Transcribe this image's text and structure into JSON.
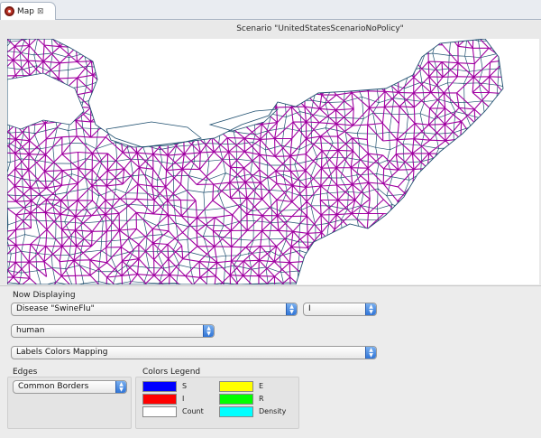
{
  "tab": {
    "label": "Map",
    "close": "⊠"
  },
  "scenario_title": "Scenario \"UnitedStatesScenarioNoPolicy\"",
  "now_displaying_label": "Now Displaying",
  "disease_select": "Disease \"SwineFlu\"",
  "state_select": "I",
  "population_select": "human",
  "labels_select": "Labels Colors Mapping",
  "edges_label": "Edges",
  "edges_select": "Common Borders",
  "legend": {
    "title": "Colors Legend",
    "items": [
      {
        "label": "S",
        "color": "#0000ff"
      },
      {
        "label": "E",
        "color": "#ffff00"
      },
      {
        "label": "I",
        "color": "#ff0000"
      },
      {
        "label": "R",
        "color": "#00ff00"
      },
      {
        "label": "Count",
        "color": "#ffffff"
      },
      {
        "label": "Density",
        "color": "#00ffff"
      }
    ]
  },
  "map_colors": {
    "border": "#1f4f6f",
    "edge": "#a000a0",
    "land": "#ffffff"
  }
}
